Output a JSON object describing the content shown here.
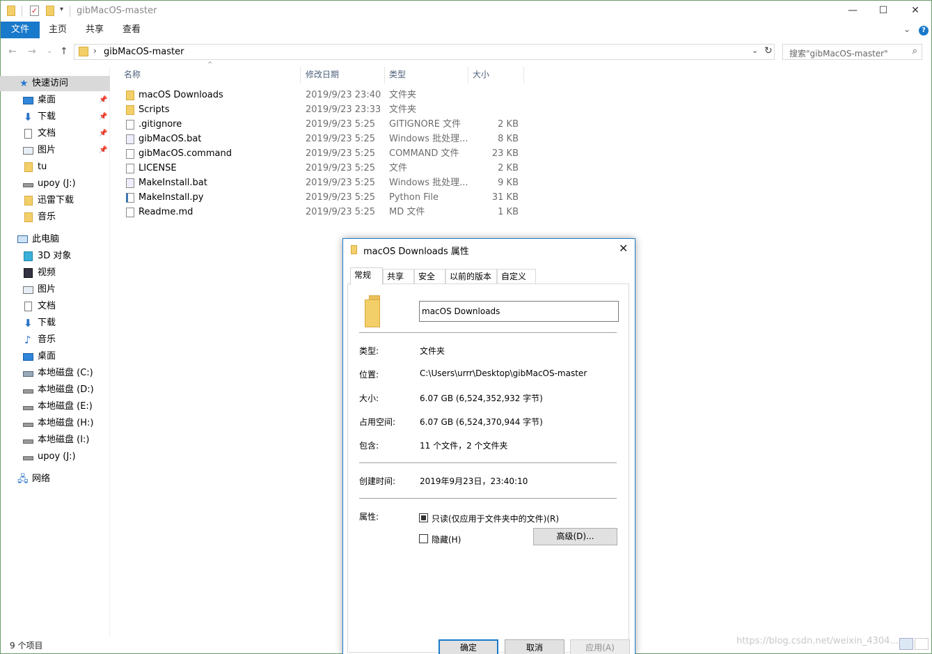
{
  "window": {
    "title": "gibMacOS-master",
    "minimize_glyph": "—",
    "maximize_glyph": "☐",
    "close_glyph": "✕"
  },
  "ribbon": {
    "tabs": [
      "文件",
      "主页",
      "共享",
      "查看"
    ],
    "expand_glyph": "⌄",
    "help_glyph": "?"
  },
  "nav": {
    "back_glyph": "←",
    "forward_glyph": "→",
    "recent_glyph": "⌄",
    "up_glyph": "↑",
    "chevron_glyph": "›",
    "path": "gibMacOS-master",
    "dropdown_glyph": "⌄",
    "refresh_glyph": "↻",
    "search_placeholder": "搜索\"gibMacOS-master\"",
    "search_glyph": "⌕"
  },
  "sidebar": {
    "items": [
      {
        "label": "快速访问",
        "icon": "star-icon",
        "pinned": false
      },
      {
        "label": "桌面",
        "icon": "desktop-icon",
        "pinned": true
      },
      {
        "label": "下载",
        "icon": "download-icon",
        "pinned": true
      },
      {
        "label": "文档",
        "icon": "document-icon",
        "pinned": true
      },
      {
        "label": "图片",
        "icon": "pictures-icon",
        "pinned": true
      },
      {
        "label": "tu",
        "icon": "folder-icon",
        "pinned": false
      },
      {
        "label": "upoy (J:)",
        "icon": "drive-icon",
        "pinned": false
      },
      {
        "label": "迅雷下载",
        "icon": "folder-icon",
        "pinned": false
      },
      {
        "label": "音乐",
        "icon": "folder-icon",
        "pinned": false
      },
      {
        "label": "此电脑",
        "icon": "computer-icon",
        "pinned": false
      },
      {
        "label": "3D 对象",
        "icon": "3d-objects-icon",
        "pinned": false
      },
      {
        "label": "视频",
        "icon": "video-icon",
        "pinned": false
      },
      {
        "label": "图片",
        "icon": "pictures-icon",
        "pinned": false
      },
      {
        "label": "文档",
        "icon": "document-icon",
        "pinned": false
      },
      {
        "label": "下载",
        "icon": "download-icon",
        "pinned": false
      },
      {
        "label": "音乐",
        "icon": "music-icon",
        "pinned": false
      },
      {
        "label": "桌面",
        "icon": "desktop-icon",
        "pinned": false
      },
      {
        "label": "本地磁盘 (C:)",
        "icon": "system-drive-icon",
        "pinned": false
      },
      {
        "label": "本地磁盘 (D:)",
        "icon": "drive-icon",
        "pinned": false
      },
      {
        "label": "本地磁盘 (E:)",
        "icon": "drive-icon",
        "pinned": false
      },
      {
        "label": "本地磁盘 (H:)",
        "icon": "drive-icon",
        "pinned": false
      },
      {
        "label": "本地磁盘 (I:)",
        "icon": "drive-icon",
        "pinned": false
      },
      {
        "label": "upoy (J:)",
        "icon": "drive-icon",
        "pinned": false
      },
      {
        "label": "网络",
        "icon": "network-icon",
        "pinned": false
      }
    ],
    "pin_glyph": "📌",
    "star_glyph": "★",
    "download_glyph": "⬇",
    "music_glyph": "♪",
    "network_glyph": "🖧"
  },
  "filelist": {
    "columns": {
      "name": "名称",
      "modified": "修改日期",
      "type": "类型",
      "size": "大小"
    },
    "sort_glyph": "^",
    "rows": [
      {
        "name": "macOS Downloads",
        "modified": "2019/9/23 23:40",
        "type": "文件夹",
        "size": "",
        "icon": "folder-icon"
      },
      {
        "name": "Scripts",
        "modified": "2019/9/23 23:33",
        "type": "文件夹",
        "size": "",
        "icon": "folder-icon"
      },
      {
        "name": ".gitignore",
        "modified": "2019/9/23 5:25",
        "type": "GITIGNORE 文件",
        "size": "2 KB",
        "icon": "file-icon"
      },
      {
        "name": "gibMacOS.bat",
        "modified": "2019/9/23 5:25",
        "type": "Windows 批处理...",
        "size": "8 KB",
        "icon": "batch-file-icon"
      },
      {
        "name": "gibMacOS.command",
        "modified": "2019/9/23 5:25",
        "type": "COMMAND 文件",
        "size": "23 KB",
        "icon": "file-icon"
      },
      {
        "name": "LICENSE",
        "modified": "2019/9/23 5:25",
        "type": "文件",
        "size": "2 KB",
        "icon": "file-icon"
      },
      {
        "name": "MakeInstall.bat",
        "modified": "2019/9/23 5:25",
        "type": "Windows 批处理...",
        "size": "9 KB",
        "icon": "batch-file-icon"
      },
      {
        "name": "MakeInstall.py",
        "modified": "2019/9/23 5:25",
        "type": "Python File",
        "size": "31 KB",
        "icon": "python-file-icon"
      },
      {
        "name": "Readme.md",
        "modified": "2019/9/23 5:25",
        "type": "MD 文件",
        "size": "1 KB",
        "icon": "file-icon"
      }
    ]
  },
  "status": {
    "item_count": "9 个项目"
  },
  "dialog": {
    "title": "macOS Downloads 属性",
    "close_glyph": "✕",
    "tabs": [
      "常规",
      "共享",
      "安全",
      "以前的版本",
      "自定义"
    ],
    "active_tab": "常规",
    "name_value": "macOS Downloads",
    "props": [
      {
        "label": "类型:",
        "value": "文件夹"
      },
      {
        "label": "位置:",
        "value": "C:\\Users\\urrr\\Desktop\\gibMacOS-master"
      },
      {
        "label": "大小:",
        "value": "6.07 GB (6,524,352,932 字节)"
      },
      {
        "label": "占用空间:",
        "value": "6.07 GB (6,524,370,944 字节)"
      },
      {
        "label": "包含:",
        "value": "11 个文件，2 个文件夹"
      }
    ],
    "created_label": "创建时间:",
    "created_value": "2019年9月23日，23:40:10",
    "attributes_label": "属性:",
    "readonly_label": "只读(仅应用于文件夹中的文件)(R)",
    "readonly_state": "indeterminate",
    "hidden_label": "隐藏(H)",
    "hidden_checked": false,
    "advanced_button": "高级(D)...",
    "ok_button": "确定",
    "cancel_button": "取消",
    "apply_button": "应用(A)"
  },
  "watermark": "https://blog.csdn.net/weixin_4304..."
}
